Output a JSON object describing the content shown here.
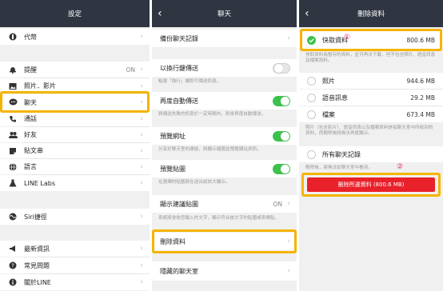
{
  "settings": {
    "title": "設定",
    "items": [
      {
        "icon": "coins-icon",
        "label": "代幣",
        "value": ""
      },
      {
        "icon": "bell-icon",
        "label": "提醒",
        "value": "ON"
      },
      {
        "icon": "image-icon",
        "label": "照片．影片",
        "value": ""
      },
      {
        "icon": "chat-bubble-icon",
        "label": "聊天",
        "value": ""
      },
      {
        "icon": "phone-icon",
        "label": "通話",
        "value": ""
      },
      {
        "icon": "people-icon",
        "label": "好友",
        "value": ""
      },
      {
        "icon": "sticker-icon",
        "label": "貼文串",
        "value": ""
      },
      {
        "icon": "globe-icon",
        "label": "語言",
        "value": ""
      },
      {
        "icon": "flask-icon",
        "label": "LINE Labs",
        "value": ""
      },
      {
        "icon": "siri-icon",
        "label": "Siri捷徑",
        "value": ""
      },
      {
        "icon": "megaphone-icon",
        "label": "最新資訊",
        "value": ""
      },
      {
        "icon": "question-icon",
        "label": "常見問題",
        "value": ""
      },
      {
        "icon": "info-icon",
        "label": "關於LINE",
        "value": ""
      }
    ]
  },
  "chat": {
    "title": "聊天",
    "backup_label": "備份聊天記錄",
    "enter_send_label": "以換行鍵傳送",
    "enter_send_desc": "點選「換行」鍵即可傳送訊息。",
    "auto_resend_label": "再度自動傳送",
    "auto_resend_desc": "將傳送失敗的訊息於一定時間內，將會再度自動傳送。",
    "preview_url_label": "預覽網址",
    "preview_url_desc": "分享於聊天室的連結，將顯示縮圖並預覽網站資訊。",
    "preview_sticker_label": "預覽貼圖",
    "preview_sticker_desc": "在選擇的貼圖將在送出前放大顯示。",
    "suggest_sticker_label": "顯示建議貼圖",
    "suggest_sticker_value": "ON",
    "suggest_sticker_desc": "系統將會依您輸入的文字，顯示符合該文字的貼圖或表情貼。",
    "delete_data_label": "刪除資料",
    "hidden_chats_label": "隱藏的聊天室"
  },
  "delete": {
    "title": "刪除資料",
    "cache_label": "快取資料",
    "cache_size": "800.6 MB",
    "cache_desc": "快取資料為暫存的資料，並可再次下載，但不包含照片、語音訊息及檔案資料。",
    "marker1": "①",
    "photos_label": "照片",
    "photos_size": "944.6 MB",
    "voice_label": "語音訊息",
    "voice_size": "29.2 MB",
    "files_label": "檔案",
    "files_size": "673.4 MB",
    "media_desc": "照片（包含影片）、語音訊息以及檔案資料是指聊天室中所收到的資料，而刪除後將無法再度顯示。",
    "all_chats_label": "所有聊天記錄",
    "all_chats_desc": "刪除後，將無法從聊天室中看到。",
    "marker2": "②",
    "delete_button_label": "刪除所選資料 (800.6 MB)"
  },
  "colors": {
    "navbar": "#2f3541",
    "highlight": "#f5b400",
    "toggle_on": "#3cc24c",
    "delete_red": "#e8212b",
    "marker": "#e0245e"
  }
}
